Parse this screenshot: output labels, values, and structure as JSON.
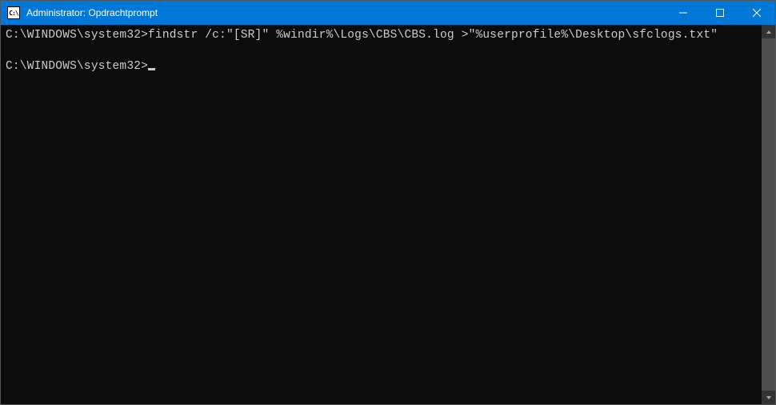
{
  "window": {
    "title": "Administrator: Opdrachtprompt",
    "icon_label": "C:\\"
  },
  "lines": [
    {
      "prompt": "C:\\WINDOWS\\system32>",
      "command": "findstr /c:\"[SR]\" %windir%\\Logs\\CBS\\CBS.log >\"%userprofile%\\Desktop\\sfclogs.txt\""
    },
    {
      "prompt": "",
      "command": ""
    },
    {
      "prompt": "C:\\WINDOWS\\system32>",
      "command": "",
      "cursor": true
    }
  ]
}
